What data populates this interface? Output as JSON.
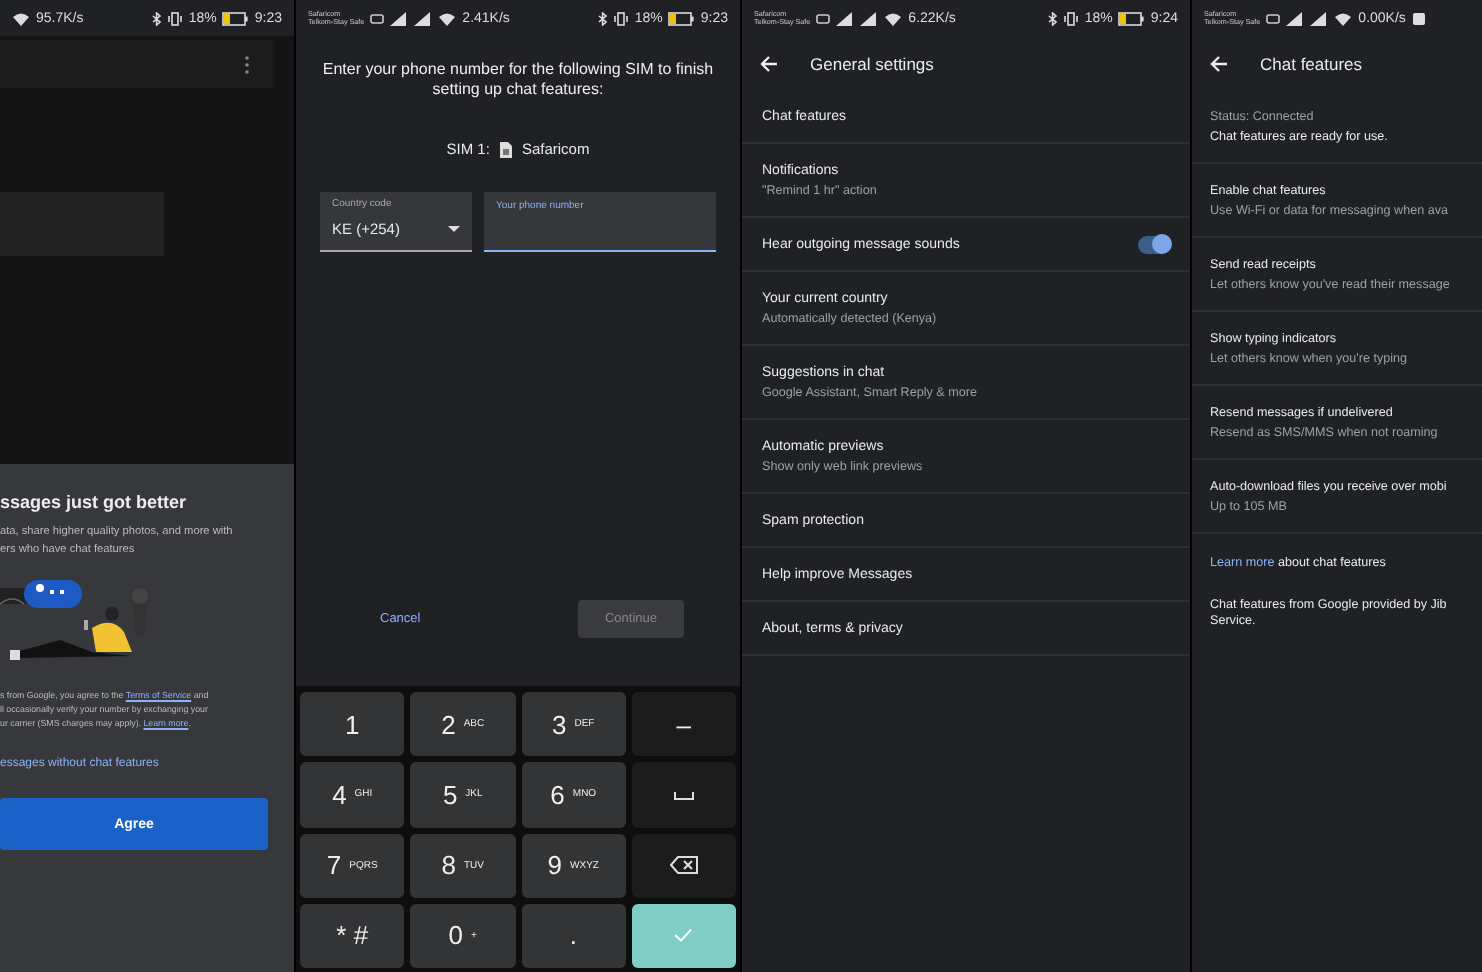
{
  "screens": [
    {
      "kind": "intro",
      "status_bar": {
        "speed": "95.7K/s",
        "battery": "18%",
        "time": "9:23"
      },
      "sheet": {
        "title": "ssages just got better",
        "body": [
          "ata, share higher quality photos, and more with",
          "ers who have chat features"
        ],
        "legal": [
          [
            {
              "kind": "text",
              "text": "s from Google, you agree to the "
            },
            {
              "kind": "link",
              "text": "Terms of Service"
            },
            {
              "kind": "text",
              "text": " and"
            }
          ],
          [
            {
              "kind": "text",
              "text": "ll occasionally verify your number by exchanging your"
            }
          ],
          [
            {
              "kind": "text",
              "text": "ur carrier (SMS charges may apply). "
            },
            {
              "kind": "link",
              "text": "Learn more"
            },
            {
              "kind": "text",
              "text": "."
            }
          ]
        ],
        "skip_link": "essages without chat features",
        "agree_button": "Agree"
      }
    },
    {
      "kind": "phone",
      "status_bar": {
        "carrier": [
          "Safaricom",
          "Telkom-Stay Safe"
        ],
        "speed": "2.41K/s",
        "battery": "18%",
        "time": "9:23"
      },
      "prompt": "Enter your phone number for the following SIM to finish setting up chat features:",
      "sim_label": "SIM 1:",
      "sim_name": "Safaricom",
      "country_field": {
        "label": "Country code",
        "value": "KE (+254)"
      },
      "phone_field": {
        "placeholder": "Your phone number",
        "focused": true
      },
      "cancel_button": "Cancel",
      "continue_button": {
        "label": "Continue",
        "disabled": true
      },
      "keypad": [
        {
          "kind": "digit",
          "main": "1"
        },
        {
          "kind": "digit",
          "main": "2",
          "letters": "ABC"
        },
        {
          "kind": "digit",
          "main": "3",
          "letters": "DEF"
        },
        {
          "kind": "symbol",
          "main": "–"
        },
        {
          "kind": "digit",
          "main": "4",
          "letters": "GHI"
        },
        {
          "kind": "digit",
          "main": "5",
          "letters": "JKL"
        },
        {
          "kind": "digit",
          "main": "6",
          "letters": "MNO"
        },
        {
          "kind": "space"
        },
        {
          "kind": "digit",
          "main": "7",
          "letters": "PQRS"
        },
        {
          "kind": "digit",
          "main": "8",
          "letters": "TUV"
        },
        {
          "kind": "digit",
          "main": "9",
          "letters": "WXYZ"
        },
        {
          "kind": "backspace"
        },
        {
          "kind": "digit",
          "main": "* #"
        },
        {
          "kind": "digit",
          "main": "0",
          "letters": "+"
        },
        {
          "kind": "digit",
          "main": "."
        },
        {
          "kind": "done"
        }
      ]
    },
    {
      "kind": "settings",
      "status_bar": {
        "carrier": [
          "Safaricom",
          "Telkom-Stay Safe"
        ],
        "speed": "6.22K/s",
        "battery": "18%",
        "time": "9:24"
      },
      "title": "General settings",
      "items": [
        {
          "title": "Chat features"
        },
        {
          "title": "Notifications",
          "subtitle": "\"Remind 1 hr\" action"
        },
        {
          "title": "Hear outgoing message sounds",
          "on": true
        },
        {
          "title": "Your current country",
          "subtitle": "Automatically detected (Kenya)"
        },
        {
          "title": "Suggestions in chat",
          "subtitle": "Google Assistant, Smart Reply & more"
        },
        {
          "title": "Automatic previews",
          "subtitle": "Show only web link previews"
        },
        {
          "title": "Spam protection"
        },
        {
          "title": "Help improve Messages"
        },
        {
          "title": "About, terms & privacy"
        }
      ]
    },
    {
      "kind": "chat",
      "status_bar": {
        "carrier": [
          "Safaricom",
          "Telkom-Stay Safe"
        ],
        "speed": "0.00K/s"
      },
      "title": "Chat features",
      "items": [
        {
          "kind": "status",
          "title": "Status: Connected",
          "subtitle": "Chat features are ready for use."
        },
        {
          "kind": "setting",
          "title": "Enable chat features",
          "subtitle": "Use Wi-Fi or data for messaging when ava"
        },
        {
          "kind": "setting",
          "title": "Send read receipts",
          "subtitle": "Let others know you've read their message"
        },
        {
          "kind": "setting",
          "title": "Show typing indicators",
          "subtitle": "Let others know when you're typing"
        },
        {
          "kind": "setting",
          "title": "Resend messages if undelivered",
          "subtitle": "Resend as SMS/MMS when not roaming"
        },
        {
          "kind": "setting",
          "title": "Auto-download files you receive over mobi",
          "subtitle": "Up to 105 MB"
        }
      ],
      "learn_more": {
        "link": "Learn more",
        "text": " about chat features"
      },
      "footer": [
        "Chat features from Google provided by Jib",
        "Service."
      ]
    }
  ]
}
